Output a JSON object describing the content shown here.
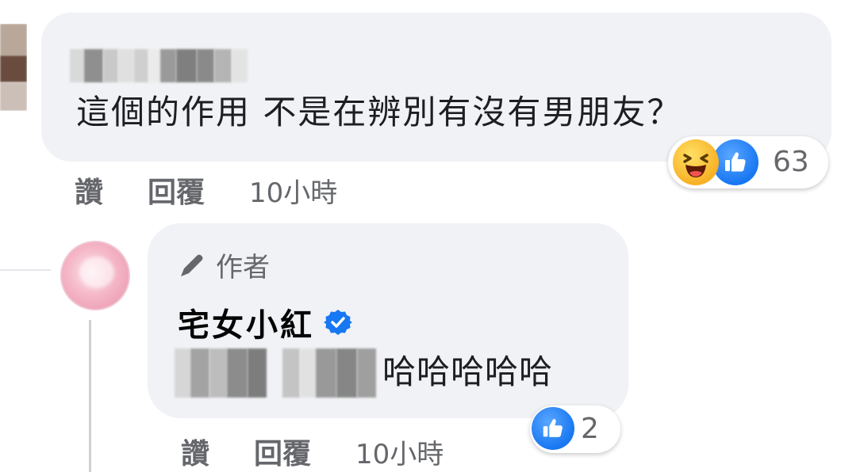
{
  "comment": {
    "text": "這個的作用 不是在辨別有沒有男朋友？",
    "reactions": {
      "icons": [
        "haha-icon",
        "like-icon"
      ],
      "count": "63"
    },
    "actions": {
      "read": "讚",
      "reply": "回覆",
      "time": "10小時"
    }
  },
  "reply": {
    "badge_label": "作者",
    "page_name": "宅女小紅",
    "text": "哈哈哈哈哈",
    "reactions": {
      "icons": [
        "like-icon"
      ],
      "count": "2"
    },
    "actions": {
      "read": "讚",
      "reply": "回覆",
      "time": "10小時"
    }
  },
  "colors": {
    "bubble_bg": "#f0f2f5",
    "secondary_text": "#65676b",
    "like_blue": "#1877f2",
    "haha_yellow": "#f7b125"
  }
}
